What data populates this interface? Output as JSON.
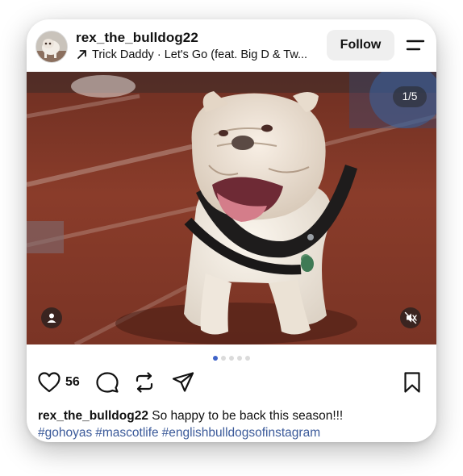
{
  "post": {
    "username": "rex_the_bulldog22",
    "audio": {
      "track": "Trick Daddy · Let's Go (feat. Big D & Tw..."
    },
    "follow_label": "Follow",
    "media_counter": "1/5",
    "carousel": {
      "total": 5,
      "active_index": 0
    },
    "likes": "56",
    "caption": {
      "username": "rex_the_bulldog22",
      "text": "So happy to be back this season!!!",
      "hashtags": [
        "#gohoyas",
        "#mascotlife",
        "#englishbulldogsofinstagram"
      ]
    }
  },
  "icons": {
    "header": [
      "music-arrow-icon",
      "menu-icon"
    ],
    "media": [
      "tag-people-icon",
      "mute-icon"
    ],
    "actions": [
      "heart-icon",
      "comment-icon",
      "repost-icon",
      "share-icon",
      "bookmark-icon"
    ]
  },
  "colors": {
    "accent": "#3f63c8",
    "hashtag": "#3b5a9a",
    "follow_bg": "#efefef",
    "dot_inactive": "#dbdbdb"
  }
}
